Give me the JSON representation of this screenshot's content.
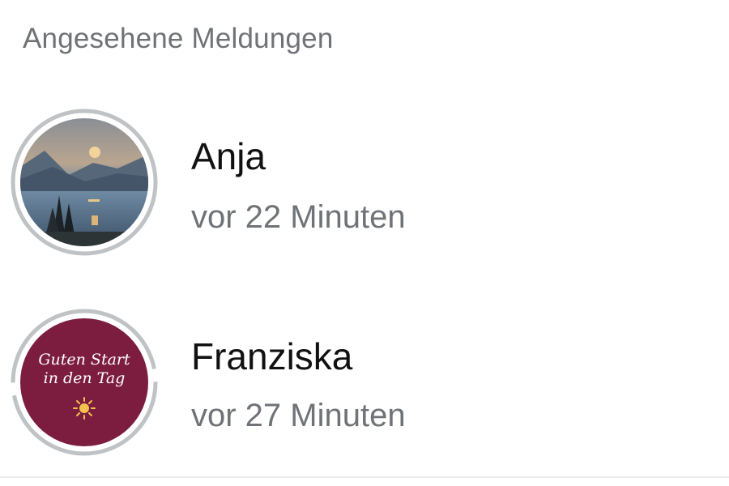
{
  "section": {
    "title": "Angesehene Meldungen"
  },
  "statuses": [
    {
      "name": "Anja",
      "time": "vor 22 Minuten",
      "avatar": "mountain-lake-sunset-photo",
      "ring_color": "#bfc3c6"
    },
    {
      "name": "Franziska",
      "time": "vor 27 Minuten",
      "avatar": "guten-start-in-den-tag-card",
      "avatar_text_line1": "Guten Start",
      "avatar_text_line2": "in den Tag",
      "avatar_bg_color": "#7c1d3f",
      "ring_color": "#bfc3c6"
    }
  ],
  "colors": {
    "secondary_text": "#6f7276",
    "primary_text": "#111111"
  }
}
